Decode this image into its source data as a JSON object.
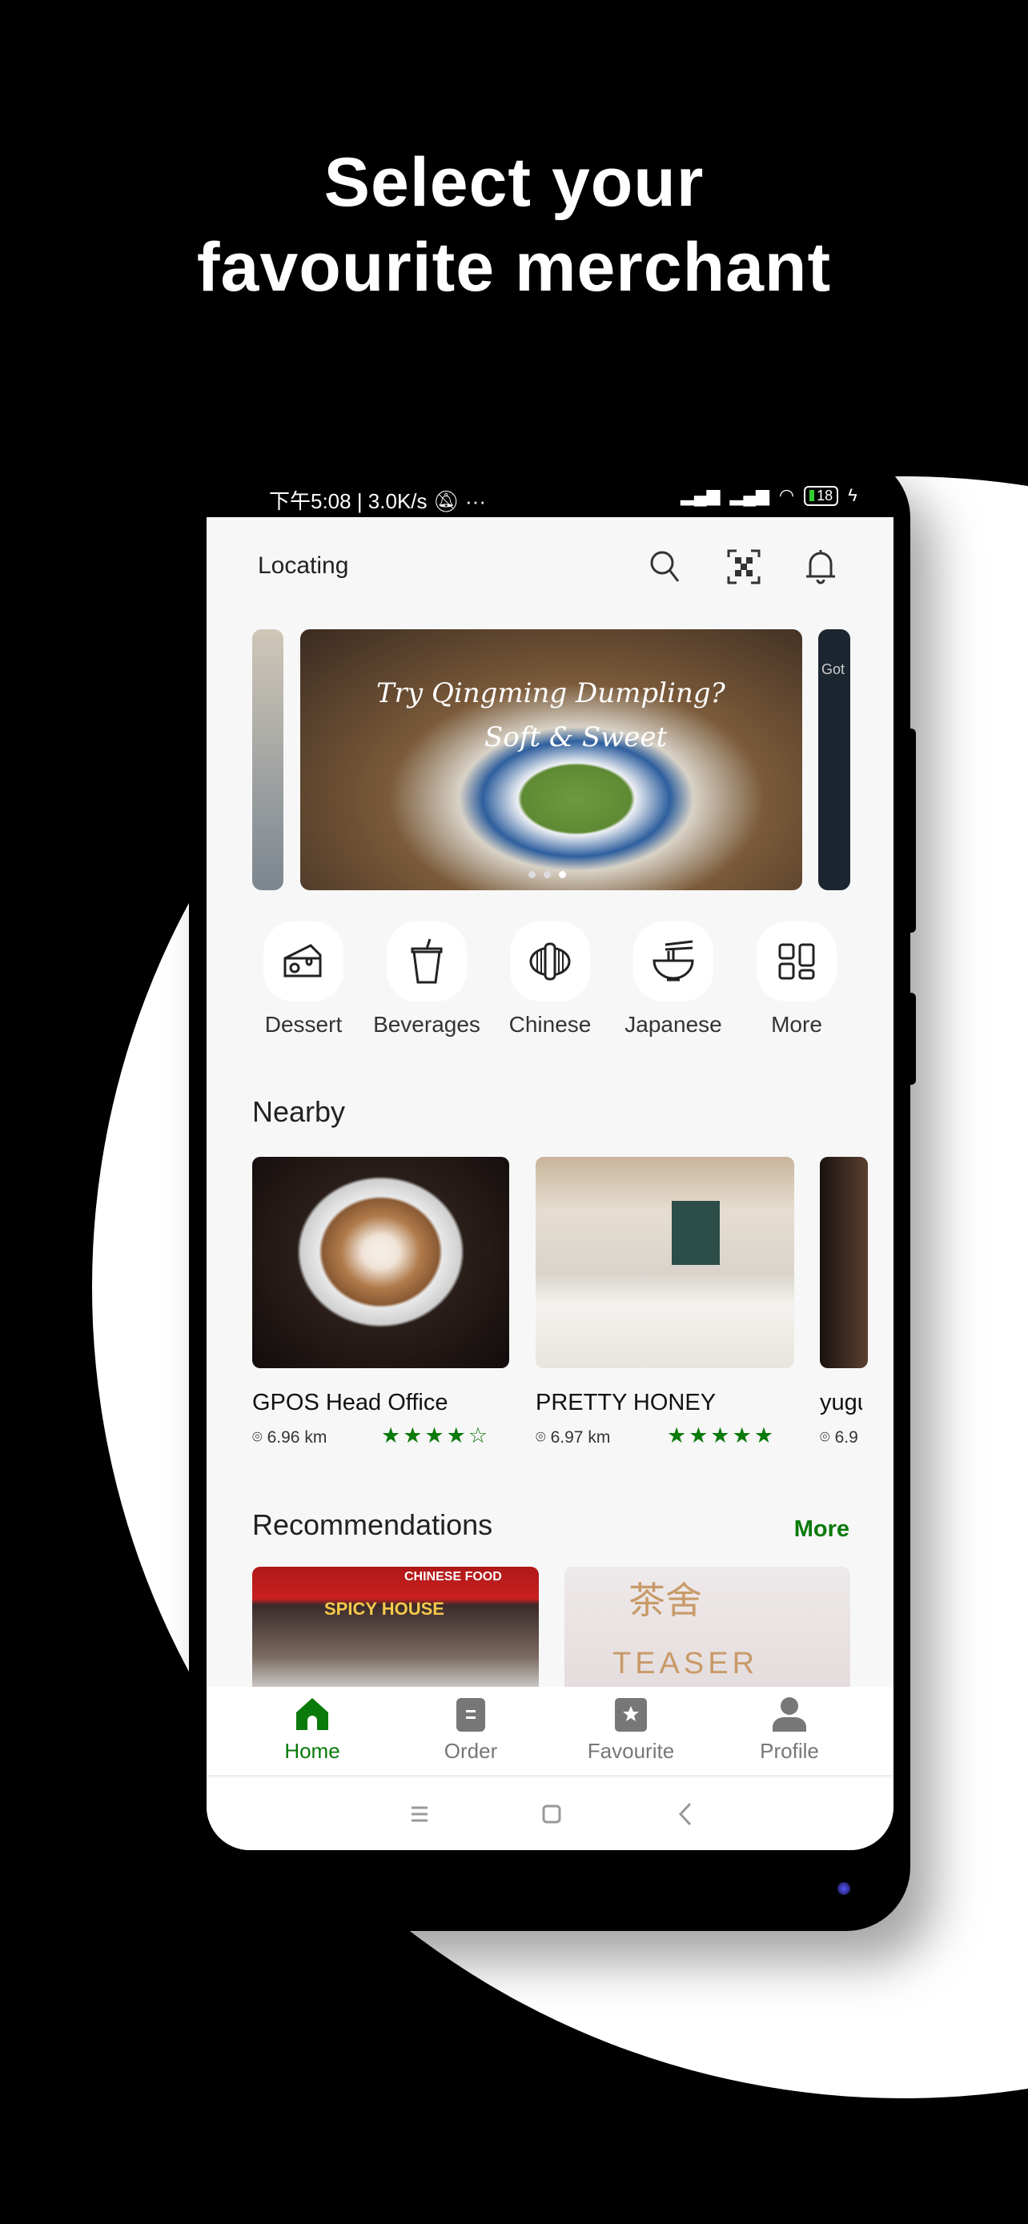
{
  "headline": {
    "line1": "Select your",
    "line2": "favourite merchant"
  },
  "status_bar": {
    "left": "下午5:08 | 3.0K/s",
    "dots": "···",
    "battery": "18"
  },
  "header": {
    "location": "Locating",
    "icons": [
      "search-icon",
      "qr-scan-icon",
      "bell-icon"
    ]
  },
  "banner": {
    "text1": "Try Qingming Dumpling?",
    "text2": "Soft & Sweet",
    "peek_text": "Got",
    "page_count": 3,
    "active_page": 3
  },
  "categories": [
    {
      "label": "Dessert",
      "icon": "cheese-cake-icon"
    },
    {
      "label": "Beverages",
      "icon": "drink-cup-icon"
    },
    {
      "label": "Chinese",
      "icon": "dim-sum-icon"
    },
    {
      "label": "Japanese",
      "icon": "noodle-bowl-icon"
    },
    {
      "label": "More",
      "icon": "grid-icon"
    }
  ],
  "nearby": {
    "title": "Nearby",
    "items": [
      {
        "name": "GPOS Head Office",
        "distance": "6.96 km",
        "rating": 4
      },
      {
        "name": "PRETTY HONEY",
        "distance": "6.97 km",
        "rating": 5
      },
      {
        "name": "yugu",
        "distance": "6.9"
      }
    ]
  },
  "recommendations": {
    "title": "Recommendations",
    "more": "More",
    "items": [
      {
        "sign": "SPICY HOUSE",
        "subsign": "CHINESE FOOD"
      },
      {
        "sign": "TEASER",
        "subsign": "茶舍"
      }
    ]
  },
  "bottom_nav": [
    {
      "label": "Home",
      "active": true
    },
    {
      "label": "Order"
    },
    {
      "label": "Favourite"
    },
    {
      "label": "Profile"
    }
  ],
  "colors": {
    "accent": "#0a7a0a",
    "inactive": "#777777"
  }
}
